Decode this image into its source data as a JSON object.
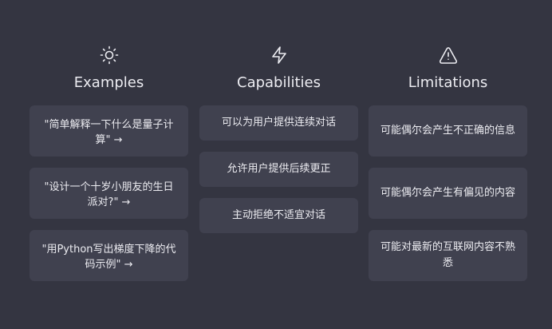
{
  "columns": [
    {
      "title": "Examples",
      "icon": "sun-icon",
      "items": [
        "\"简单解释一下什么是量子计算\" →",
        "\"设计一个十岁小朋友的生日派对?\" →",
        "\"用Python写出梯度下降的代码示例\" →"
      ]
    },
    {
      "title": "Capabilities",
      "icon": "lightning-bolt-icon",
      "items": [
        "可以为用户提供连续对话",
        "允许用户提供后续更正",
        "主动拒绝不适宜对话"
      ]
    },
    {
      "title": "Limitations",
      "icon": "warning-triangle-icon",
      "items": [
        "可能偶尔会产生不正确的信息",
        "可能偶尔会产生有偏见的内容",
        "可能对最新的互联网内容不熟悉"
      ]
    }
  ],
  "colors": {
    "background": "#343541",
    "card": "#40414f",
    "text": "#ececf1"
  }
}
